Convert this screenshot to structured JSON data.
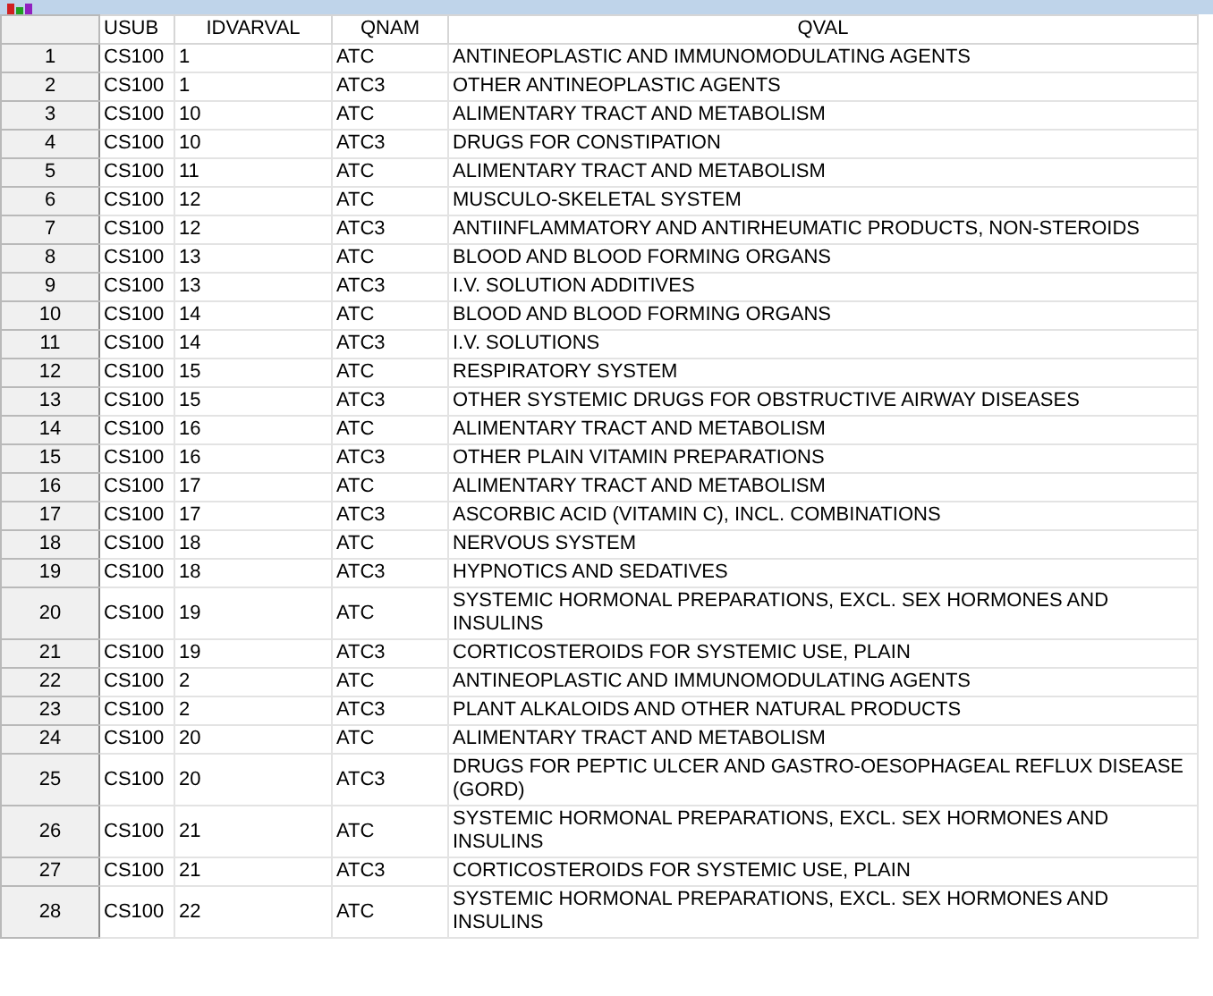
{
  "table": {
    "columns": [
      "USUB",
      "IDVARVAL",
      "QNAM",
      "QVAL"
    ],
    "rows": [
      {
        "n": "1",
        "c": [
          "CS100",
          "1",
          "ATC",
          "ANTINEOPLASTIC AND IMMUNOMODULATING AGENTS"
        ]
      },
      {
        "n": "2",
        "c": [
          "CS100",
          "1",
          "ATC3",
          "OTHER ANTINEOPLASTIC AGENTS"
        ]
      },
      {
        "n": "3",
        "c": [
          "CS100",
          "10",
          "ATC",
          "ALIMENTARY TRACT AND METABOLISM"
        ]
      },
      {
        "n": "4",
        "c": [
          "CS100",
          "10",
          "ATC3",
          "DRUGS FOR CONSTIPATION"
        ]
      },
      {
        "n": "5",
        "c": [
          "CS100",
          "11",
          "ATC",
          "ALIMENTARY TRACT AND METABOLISM"
        ]
      },
      {
        "n": "6",
        "c": [
          "CS100",
          "12",
          "ATC",
          "MUSCULO-SKELETAL SYSTEM"
        ]
      },
      {
        "n": "7",
        "c": [
          "CS100",
          "12",
          "ATC3",
          "ANTIINFLAMMATORY AND ANTIRHEUMATIC PRODUCTS, NON-STEROIDS"
        ]
      },
      {
        "n": "8",
        "c": [
          "CS100",
          "13",
          "ATC",
          "BLOOD AND BLOOD FORMING ORGANS"
        ]
      },
      {
        "n": "9",
        "c": [
          "CS100",
          "13",
          "ATC3",
          "I.V. SOLUTION ADDITIVES"
        ]
      },
      {
        "n": "10",
        "c": [
          "CS100",
          "14",
          "ATC",
          "BLOOD AND BLOOD FORMING ORGANS"
        ]
      },
      {
        "n": "11",
        "c": [
          "CS100",
          "14",
          "ATC3",
          "I.V. SOLUTIONS"
        ]
      },
      {
        "n": "12",
        "c": [
          "CS100",
          "15",
          "ATC",
          "RESPIRATORY SYSTEM"
        ]
      },
      {
        "n": "13",
        "c": [
          "CS100",
          "15",
          "ATC3",
          "OTHER SYSTEMIC DRUGS FOR OBSTRUCTIVE AIRWAY DISEASES"
        ]
      },
      {
        "n": "14",
        "c": [
          "CS100",
          "16",
          "ATC",
          "ALIMENTARY TRACT AND METABOLISM"
        ]
      },
      {
        "n": "15",
        "c": [
          "CS100",
          "16",
          "ATC3",
          "OTHER PLAIN VITAMIN PREPARATIONS"
        ]
      },
      {
        "n": "16",
        "c": [
          "CS100",
          "17",
          "ATC",
          "ALIMENTARY TRACT AND METABOLISM"
        ]
      },
      {
        "n": "17",
        "c": [
          "CS100",
          "17",
          "ATC3",
          "ASCORBIC ACID (VITAMIN C), INCL. COMBINATIONS"
        ]
      },
      {
        "n": "18",
        "c": [
          "CS100",
          "18",
          "ATC",
          "NERVOUS SYSTEM"
        ]
      },
      {
        "n": "19",
        "c": [
          "CS100",
          "18",
          "ATC3",
          "HYPNOTICS AND SEDATIVES"
        ]
      },
      {
        "n": "20",
        "c": [
          "CS100",
          "19",
          "ATC",
          "SYSTEMIC HORMONAL PREPARATIONS, EXCL. SEX HORMONES AND INSULINS"
        ]
      },
      {
        "n": "21",
        "c": [
          "CS100",
          "19",
          "ATC3",
          "CORTICOSTEROIDS FOR SYSTEMIC USE, PLAIN"
        ]
      },
      {
        "n": "22",
        "c": [
          "CS100",
          "2",
          "ATC",
          "ANTINEOPLASTIC AND IMMUNOMODULATING AGENTS"
        ]
      },
      {
        "n": "23",
        "c": [
          "CS100",
          "2",
          "ATC3",
          "PLANT ALKALOIDS AND OTHER NATURAL PRODUCTS"
        ]
      },
      {
        "n": "24",
        "c": [
          "CS100",
          "20",
          "ATC",
          "ALIMENTARY TRACT AND METABOLISM"
        ]
      },
      {
        "n": "25",
        "c": [
          "CS100",
          "20",
          "ATC3",
          "DRUGS FOR PEPTIC ULCER AND GASTRO-OESOPHAGEAL REFLUX DISEASE (GORD)"
        ]
      },
      {
        "n": "26",
        "c": [
          "CS100",
          "21",
          "ATC",
          "SYSTEMIC HORMONAL PREPARATIONS, EXCL. SEX HORMONES AND INSULINS"
        ]
      },
      {
        "n": "27",
        "c": [
          "CS100",
          "21",
          "ATC3",
          "CORTICOSTEROIDS FOR SYSTEMIC USE, PLAIN"
        ]
      },
      {
        "n": "28",
        "c": [
          "CS100",
          "22",
          "ATC",
          "SYSTEMIC HORMONAL PREPARATIONS, EXCL. SEX HORMONES AND INSULINS"
        ]
      }
    ]
  }
}
